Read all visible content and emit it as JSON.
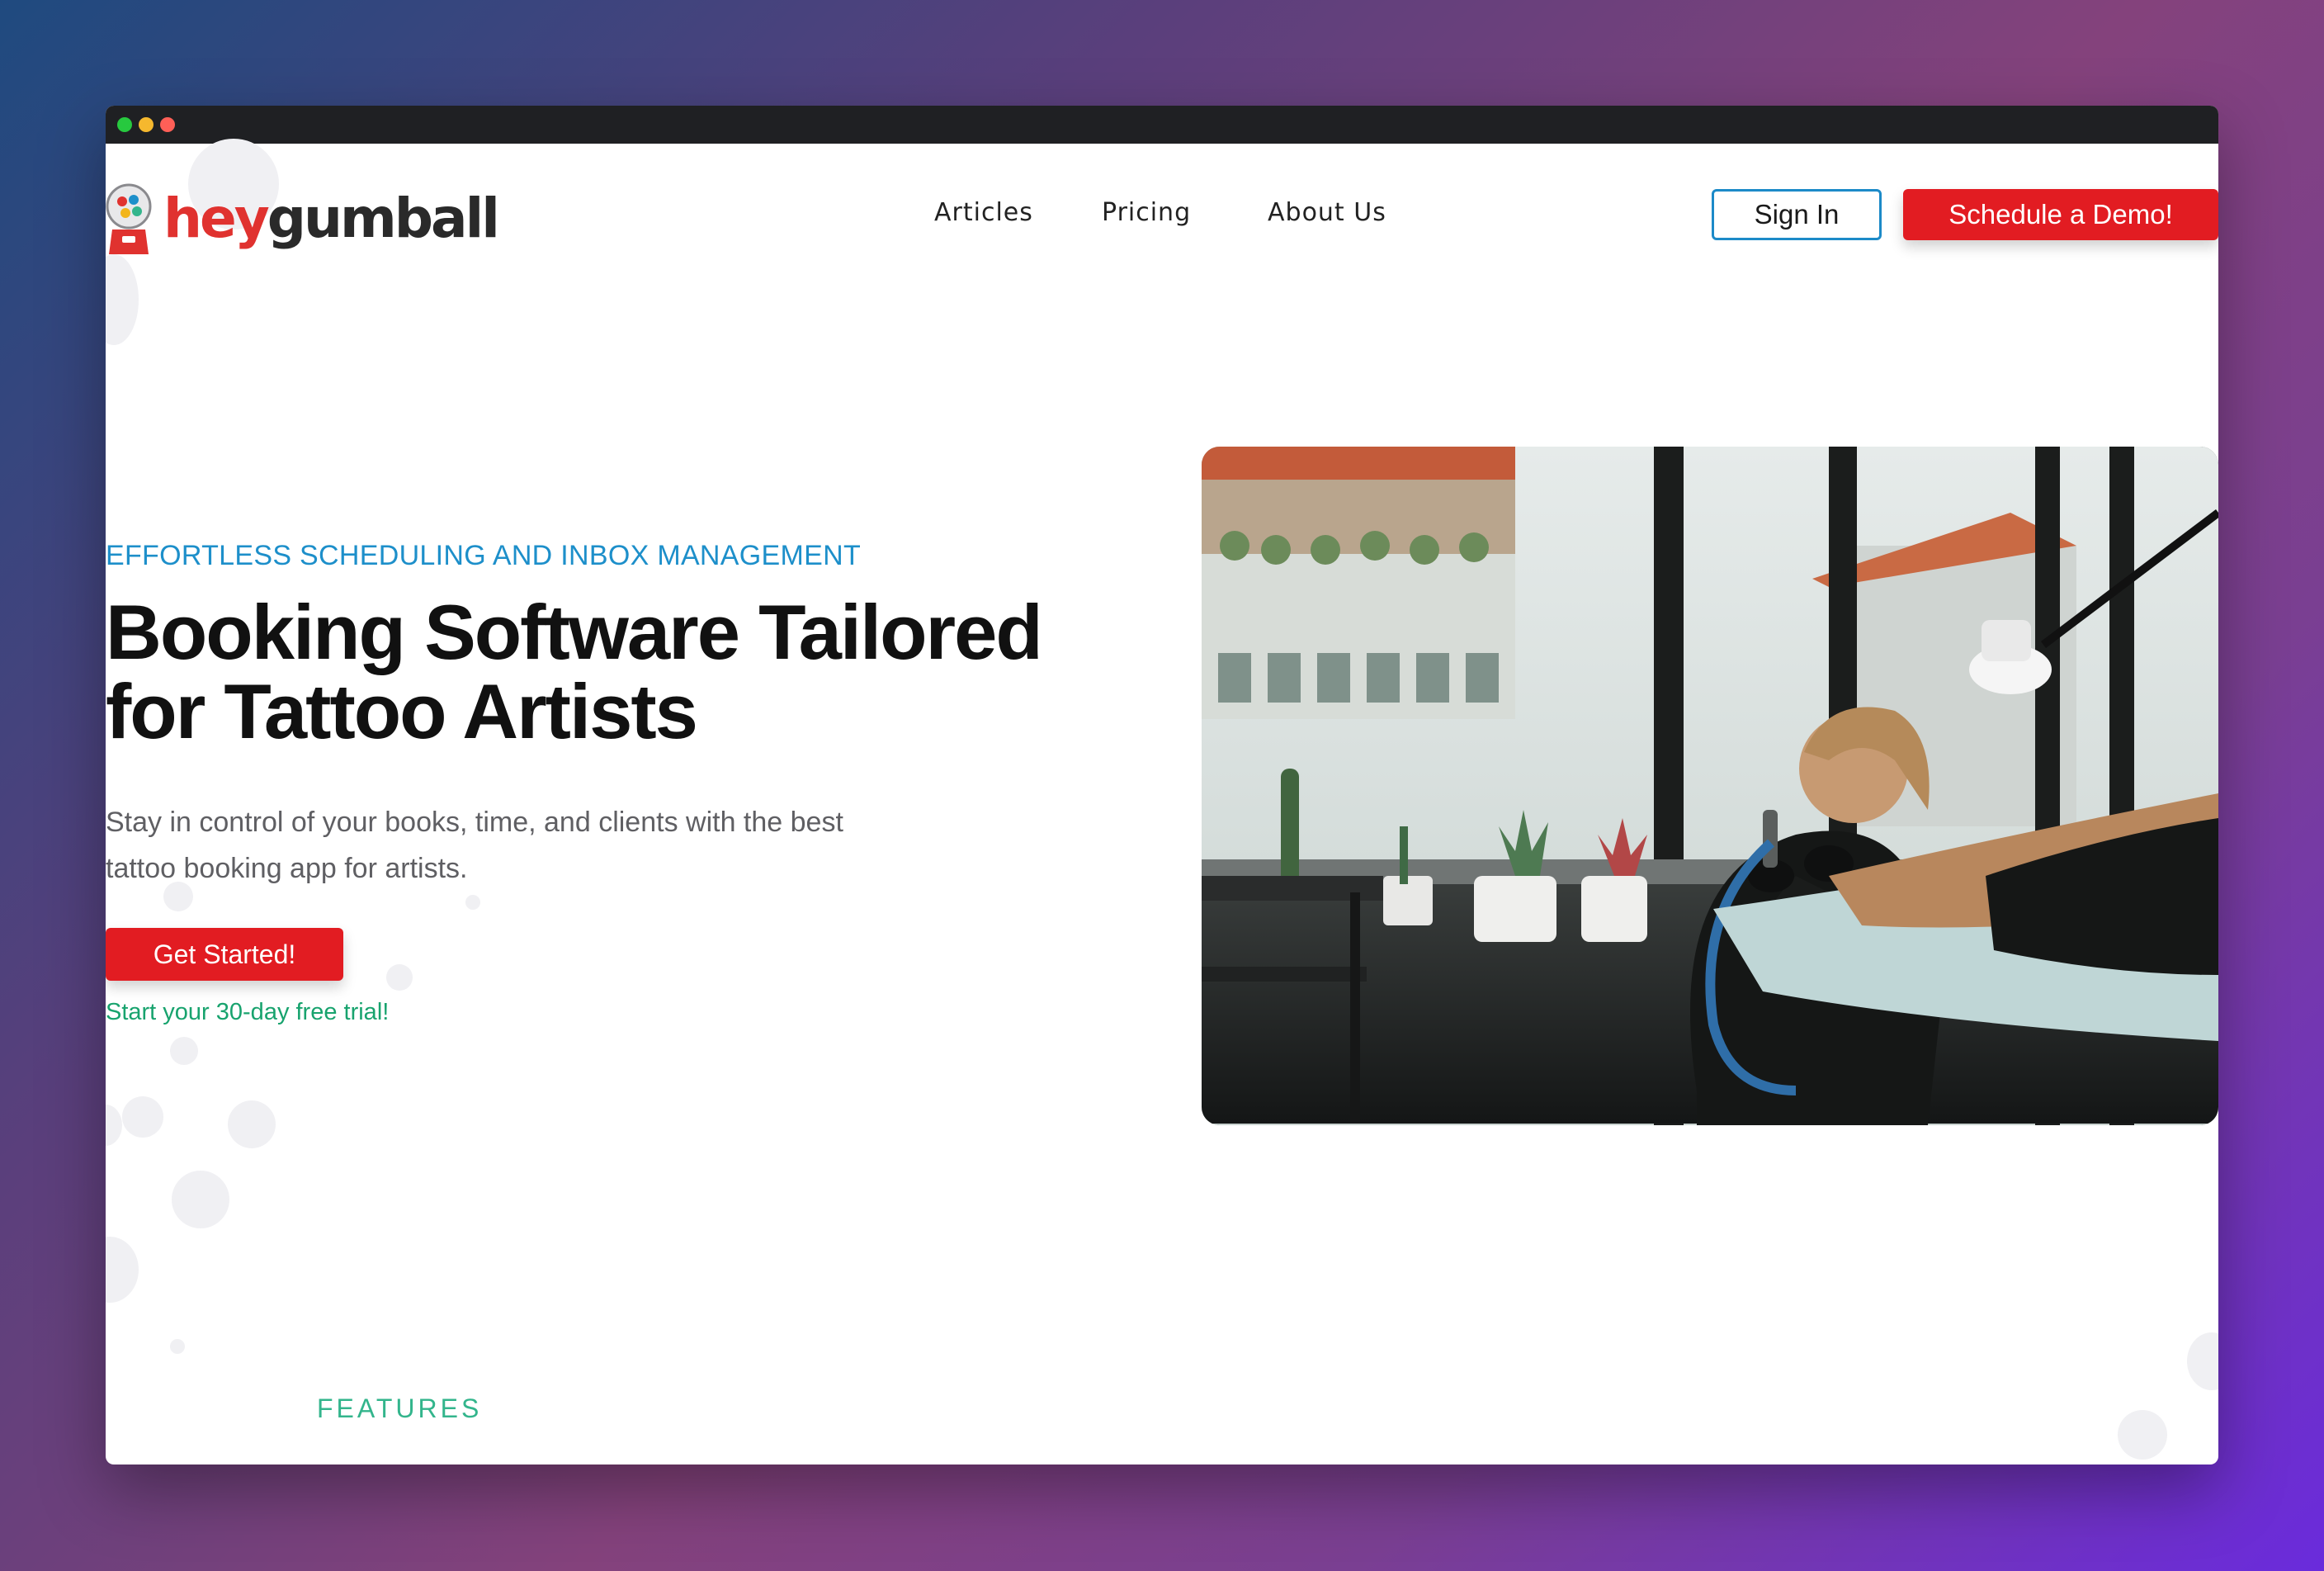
{
  "brand": {
    "name_prefix": "hey",
    "name_suffix": "gumball",
    "logo_icon": "gumball-machine-icon",
    "primary_color": "#e21c22",
    "accent_blue": "#1d8fca",
    "accent_green": "#18a36e"
  },
  "window": {
    "controls": [
      "green",
      "yellow",
      "red"
    ]
  },
  "nav": {
    "items": [
      {
        "label": "Articles"
      },
      {
        "label": "Pricing"
      },
      {
        "label": "About Us"
      }
    ],
    "sign_in_label": "Sign In",
    "demo_label": "Schedule a Demo!"
  },
  "hero": {
    "eyebrow": "EFFORTLESS SCHEDULING AND INBOX MANAGEMENT",
    "headline": "Booking Software Tailored for Tattoo Artists",
    "subtext": "Stay in control of your books, time, and clients with the best tattoo booking app for artists.",
    "cta_label": "Get Started!",
    "trial_text": "Start your 30-day free trial!",
    "image_subject": "tattoo-artist-photo"
  },
  "sections": {
    "features_label": "FEATURES"
  }
}
